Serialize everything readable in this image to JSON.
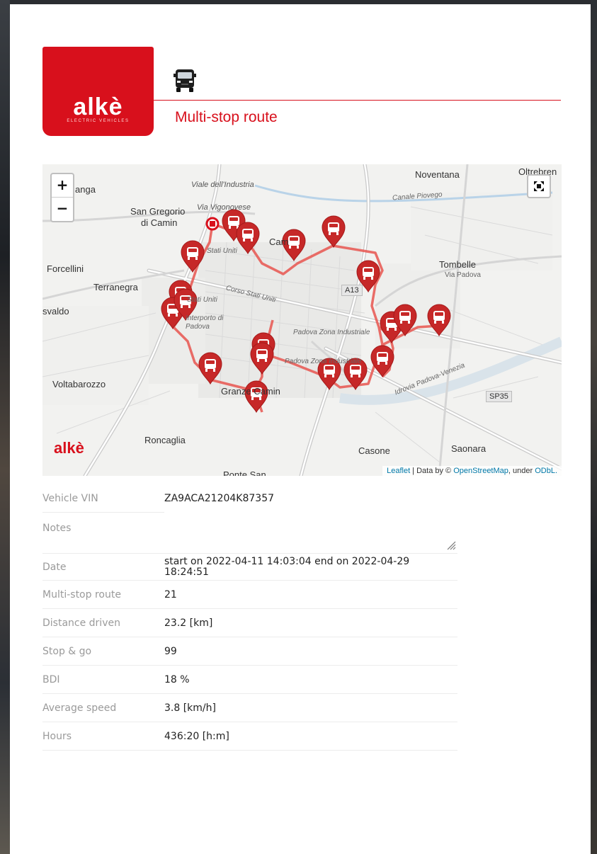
{
  "brand": {
    "logo_text": "alkè",
    "logo_sub": "ELECTRIC VEHICLES",
    "color": "#d8101c"
  },
  "header": {
    "vehicle_icon": "van-icon",
    "title": "Multi-stop route"
  },
  "map": {
    "controls": {
      "zoom_in": "+",
      "zoom_out": "−",
      "fullscreen_icon": "fullscreen-icon"
    },
    "places": {
      "noventana": "Noventana",
      "oltrebrenta": "Oltrebren",
      "padova_partial": "anga",
      "san_gregorio": "San Gregorio",
      "di_camin": "di Camin",
      "forcellini": "Forcellini",
      "terranegra": "Terranegra",
      "svaldo": "svaldo",
      "voltabarozzo": "Voltabarozzo",
      "roncaglia": "Roncaglia",
      "granze_camin": "Granze Camin",
      "ponte_san": "Ponte San",
      "casone": "Casone",
      "saonara": "Saonara",
      "tombelle": "Tombelle",
      "cam_partial": "Cam"
    },
    "streets": {
      "viale_industria": "Viale dell'Industria",
      "via_vigonovese": "Via Vigonovese",
      "canale_piovego": "Canale Piovego",
      "stati_uniti_a": "Stati Uniti",
      "stati_uniti_b": "Stati Uniti",
      "corso_stati_uniti": "Corso Stati Uniti",
      "interporto": "Interporto di Padova",
      "zona_industriale_a": "Padova Zona Industriale",
      "zona_industriale_b": "Padova Zona Industriale",
      "idrovia": "Idrovia Padova-Venezia",
      "via_padova": "Via Padova"
    },
    "shields": {
      "a13": "A13",
      "sp35": "SP35"
    },
    "watermark": "alkè",
    "attribution": {
      "leaflet": "Leaflet",
      "sep": " | Data by © ",
      "osm": "OpenStreetMap",
      "under": ", under ",
      "odbl": "ODbL."
    },
    "route_color": "#e8554f",
    "marker_color": "#c62828",
    "marker_icon": "van-marker-icon",
    "start_icon": "start-marker-icon",
    "stop_count": 21
  },
  "details": {
    "vin": {
      "label": "Vehicle VIN",
      "value": "ZA9ACA21204K87357"
    },
    "notes": {
      "label": "Notes",
      "value": ""
    },
    "date": {
      "label": "Date",
      "value_line1": "start on 2022-04-11 14:03:04 end on 2022-04-29",
      "value_line2": "18:24:51"
    },
    "stops": {
      "label": "Multi-stop route",
      "value": "21"
    },
    "distance": {
      "label": "Distance driven",
      "value": "23.2 [km]"
    },
    "stop_go": {
      "label": "Stop & go",
      "value": "99"
    },
    "bdi": {
      "label": "BDI",
      "value": "18 %"
    },
    "avg_speed": {
      "label": "Average speed",
      "value": "3.8 [km/h]"
    },
    "hours": {
      "label": "Hours",
      "value": "436:20 [h:m]"
    }
  }
}
